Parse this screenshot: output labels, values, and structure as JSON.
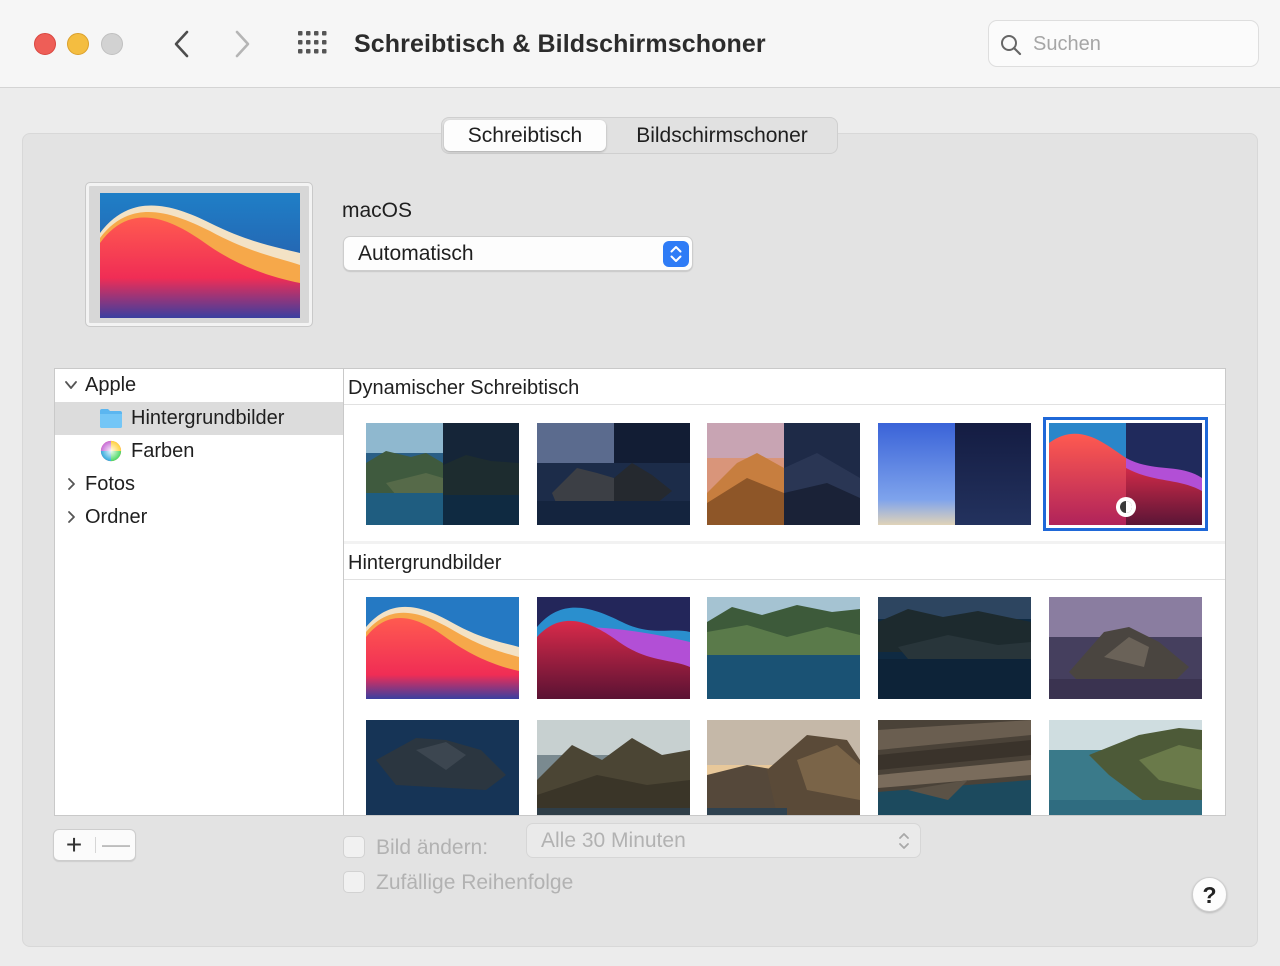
{
  "window": {
    "title": "Schreibtisch & Bildschirmschoner",
    "search_placeholder": "Suchen"
  },
  "icons": {
    "close": "close-icon",
    "minimize": "minimize-icon",
    "zoom": "zoom-icon",
    "back": "chevron-left-icon",
    "forward": "chevron-right-icon",
    "all_prefs": "grid-icon",
    "search": "search-icon"
  },
  "tabs": [
    {
      "label": "Schreibtisch",
      "selected": true
    },
    {
      "label": "Bildschirmschoner",
      "selected": false
    }
  ],
  "current": {
    "collection": "macOS",
    "mode": "Automatisch"
  },
  "sidebar": {
    "items": [
      {
        "label": "Apple",
        "expanded": true,
        "icon": "chevron-down-icon"
      },
      {
        "label": "Hintergrundbilder",
        "selected": true,
        "icon": "folder-icon"
      },
      {
        "label": "Farben",
        "icon": "color-wheel-icon"
      },
      {
        "label": "Fotos",
        "expanded": false,
        "icon": "chevron-right-icon"
      },
      {
        "label": "Ordner",
        "expanded": false,
        "icon": "chevron-right-icon"
      }
    ]
  },
  "sections": {
    "dynamic": "Dynamischer Schreibtisch",
    "wallpapers": "Hintergrundbilder"
  },
  "controls": {
    "add": "+",
    "remove": "—",
    "change_picture": "Bild ändern:",
    "interval": "Alle 30 Minuten",
    "random_order": "Zufällige Reihenfolge",
    "help": "?"
  },
  "colors": {
    "accent": "#2f7cf6",
    "selection_outline": "#1f68d8",
    "close": "#ee5e57",
    "minimize": "#f4bd40"
  }
}
